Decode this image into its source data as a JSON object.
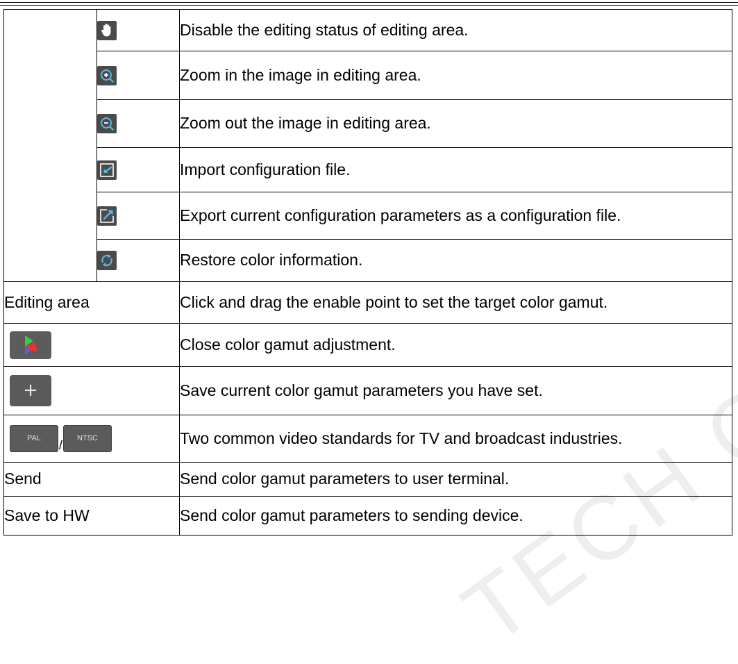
{
  "watermark": "TECH CO., LTD",
  "rows": {
    "hand": "Disable the editing status of editing area.",
    "zoom_in": "Zoom in the image in editing area.",
    "zoom_out": "Zoom out the image in editing area.",
    "import": "Import configuration file.",
    "export": "Export current configuration parameters as a configuration file.",
    "restore": "Restore color information.",
    "editing_area": {
      "label": "Editing area",
      "desc": "Click and drag the enable point to set the target color gamut."
    },
    "close_gamut": "Close color gamut adjustment.",
    "save_params": "Save current color gamut parameters you have set.",
    "standards": {
      "pal_label": "PAL",
      "separator": "/",
      "ntsc_label": "NTSC",
      "desc": "Two common video standards for TV and broadcast industries."
    },
    "send": {
      "label": "Send",
      "desc": "Send color gamut parameters to user terminal."
    },
    "save_hw": {
      "label": "Save to HW",
      "desc": "Send color gamut parameters to sending device."
    }
  },
  "icons": {
    "hand": "hand-icon",
    "zoom_in": "zoom-in-icon",
    "zoom_out": "zoom-out-icon",
    "import": "import-icon",
    "export": "export-icon",
    "restore": "restore-icon",
    "gamut": "color-gamut-icon",
    "plus": "+"
  },
  "colors": {
    "icon_bg": "#4a4a4a",
    "icon_accent": "#58b8e6",
    "gamut_green": "#3cc84a",
    "gamut_blue": "#3a6fe0",
    "gamut_red": "#e63434"
  }
}
